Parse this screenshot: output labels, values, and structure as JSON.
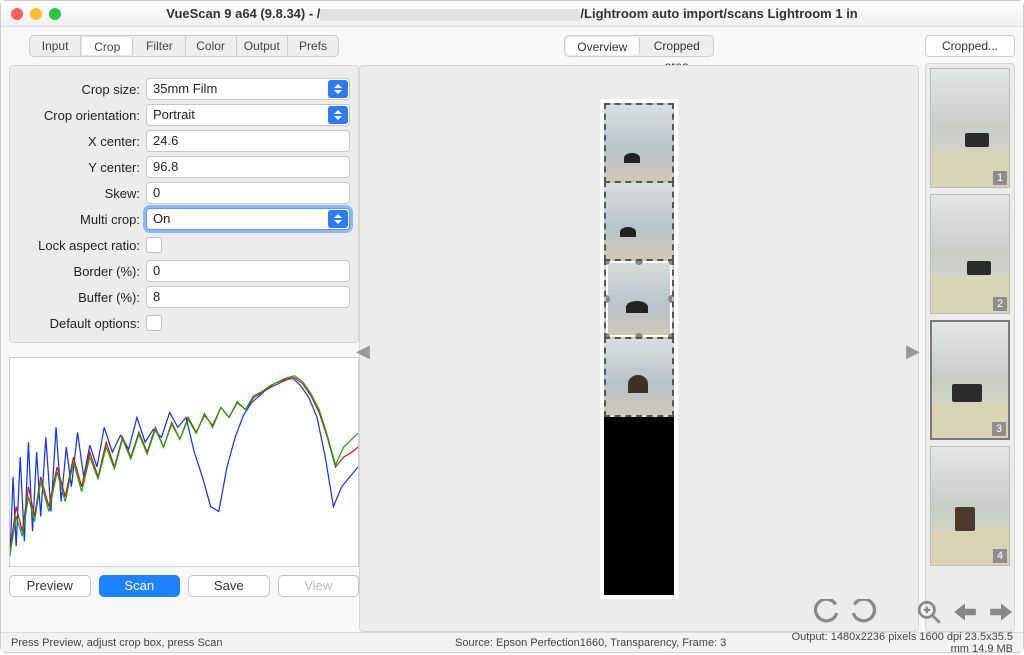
{
  "window": {
    "title_prefix": "VueScan 9 a64 (9.8.34) - /",
    "title_suffix": "/Lightroom auto import/scans Lightroom 1 in"
  },
  "tabs": {
    "items": [
      "Input",
      "Crop",
      "Filter",
      "Color",
      "Output",
      "Prefs"
    ],
    "active": "Crop"
  },
  "form": {
    "crop_size": {
      "label": "Crop size:",
      "value": "35mm Film",
      "type": "select"
    },
    "crop_orientation": {
      "label": "Crop orientation:",
      "value": "Portrait",
      "type": "select"
    },
    "x_center": {
      "label": "X center:",
      "value": "24.6"
    },
    "y_center": {
      "label": "Y center:",
      "value": "96.8"
    },
    "skew": {
      "label": "Skew:",
      "value": "0"
    },
    "multi_crop": {
      "label": "Multi crop:",
      "value": "On",
      "type": "select",
      "focused": true
    },
    "lock_aspect": {
      "label": "Lock aspect ratio:",
      "checked": false,
      "type": "checkbox"
    },
    "border": {
      "label": "Border (%):",
      "value": "0"
    },
    "buffer": {
      "label": "Buffer (%):",
      "value": "8"
    },
    "default_opts": {
      "label": "Default options:",
      "checked": false,
      "type": "checkbox"
    }
  },
  "buttons": {
    "preview": "Preview",
    "scan": "Scan",
    "save": "Save",
    "view": "View"
  },
  "preview_tabs": {
    "items": [
      "Overview",
      "Cropped area"
    ],
    "active": "Overview"
  },
  "right_panel": {
    "tab": "Cropped...",
    "thumbnails": [
      {
        "num": "1",
        "selected": false
      },
      {
        "num": "2",
        "selected": false
      },
      {
        "num": "3",
        "selected": true
      },
      {
        "num": "4",
        "selected": false
      }
    ]
  },
  "status": {
    "hint": "Press Preview, adjust crop box, press Scan",
    "source": "Source: Epson Perfection1660, Transparency, Frame: 3",
    "output": "Output: 1480x2236 pixels 1600 dpi 23.5x35.5 mm 14.9 MB"
  },
  "icons": {
    "undo": "undo-icon",
    "redo": "redo-icon",
    "zoom_in": "zoom-in-icon",
    "left": "arrow-left-icon",
    "right": "arrow-right-icon"
  }
}
